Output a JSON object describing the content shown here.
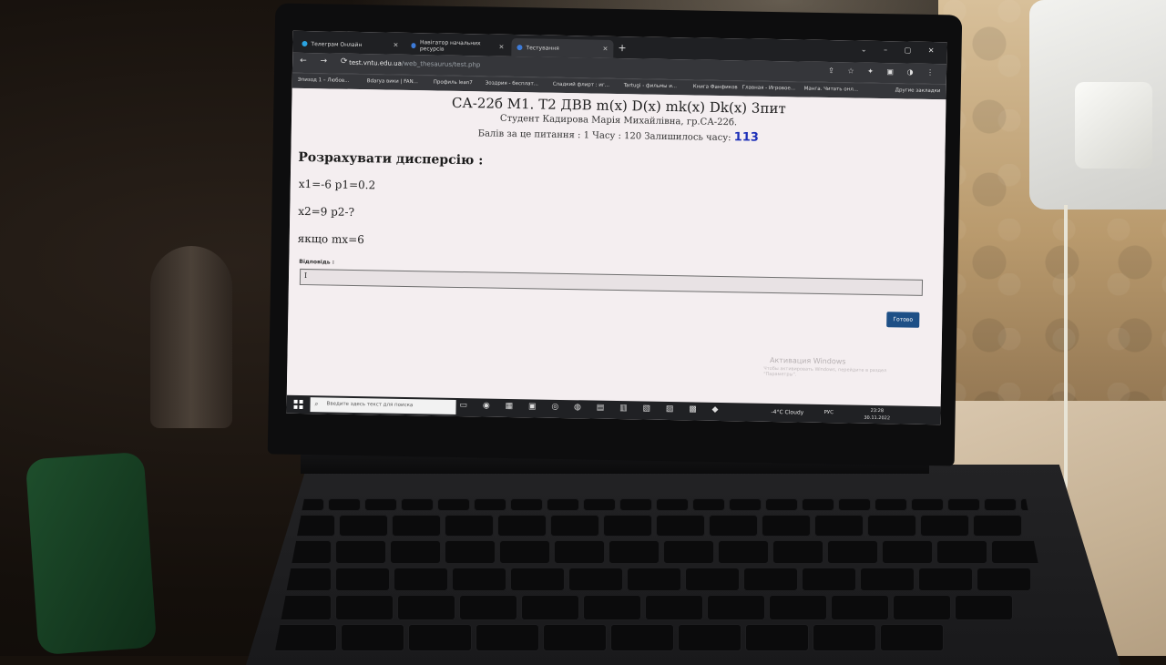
{
  "browser": {
    "tabs": [
      {
        "label": "Телеграм Онлайн",
        "icon": "telegram-icon",
        "color": "#2aa3e0"
      },
      {
        "label": "Навігатор начальних ресурсів",
        "icon": "page-icon",
        "color": "#3d7bd8"
      },
      {
        "label": "Тестування",
        "icon": "page-icon",
        "color": "#3d7bd8"
      }
    ],
    "url_host": "test.vntu.edu.ua",
    "url_path": "/web_thesaurus/test.php",
    "bookmarks": [
      "Эпизод 1 – Любов...",
      "Bdarya вики | FAN...",
      "Профиль lean7",
      "Зоздрия - бесплат...",
      "Сладкий флирт : иг...",
      "Tartugi - фильмы и...",
      "Книга Фанфиков",
      "Главная - Игровое...",
      "Манга. Читать онл...",
      "Другие закладки"
    ]
  },
  "test": {
    "title": "СА-22б М1. Т2 ДВВ m(x) D(x) mk(x) Dk(x) 3пит",
    "student": "Студент Кадирова Марія Михайлівна, гр.СА-22б.",
    "info": "Балів за це питання : 1 Часу : 120 Залишилось часу:",
    "time_left": "113",
    "question": "Розрахувати дисперсію :",
    "lines": [
      "x1=-6  p1=0.2",
      "x2=9  p2-?",
      "якщо mx=6"
    ],
    "answer_label": "Відповідь :",
    "answer_value": "I",
    "submit_label": "Готово"
  },
  "watermark": {
    "title": "Активация Windows",
    "text": "Чтобы активировать Windows, перейдите в раздел \"Параметры\"."
  },
  "taskbar": {
    "search_placeholder": "Введите здесь текст для поиска",
    "weather": "-4°C Cloudy",
    "lang": "РУС",
    "time": "23:28",
    "date": "30.11.2022"
  }
}
